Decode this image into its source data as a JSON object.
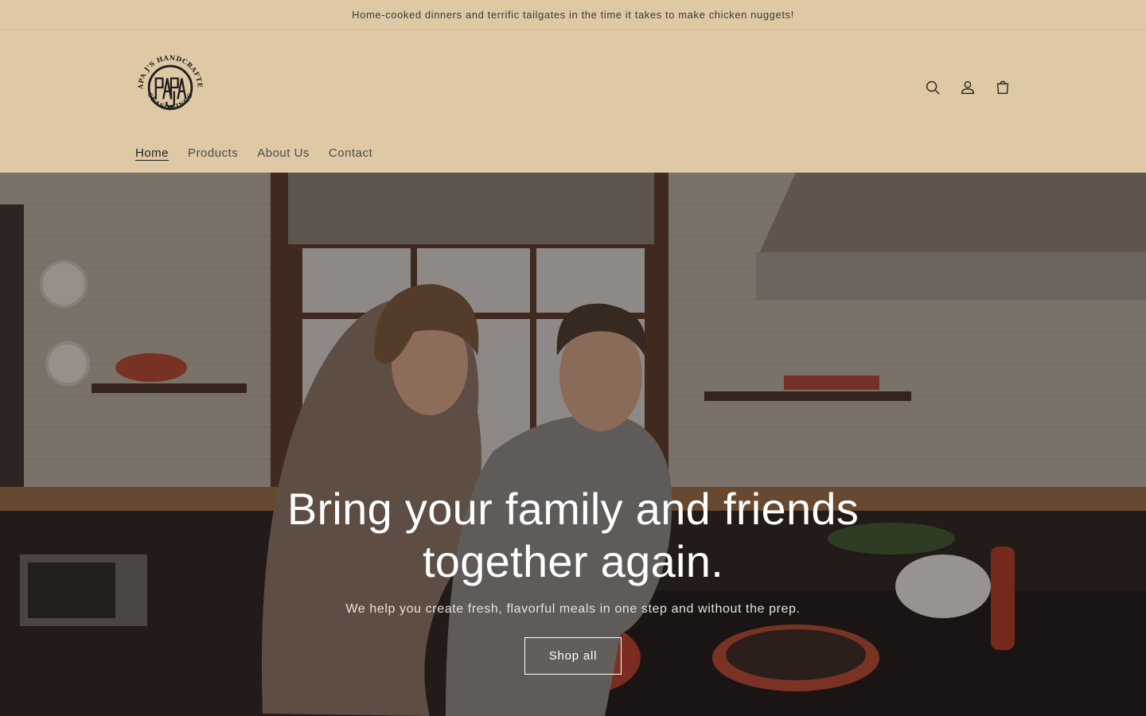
{
  "announcement": {
    "text": "Home-cooked dinners and terrific tailgates in the time it takes to make chicken nuggets!"
  },
  "header": {
    "logo_text_top": "PAPA J'S HANDCRAFTED",
    "logo_text_bottom": "SEASONINGS",
    "logo_monogram": "PAPA J",
    "icons": {
      "search": "search-icon",
      "account": "user-icon",
      "cart": "cart-icon"
    }
  },
  "nav": {
    "items": [
      {
        "label": "Home",
        "active": true
      },
      {
        "label": "Products",
        "active": false
      },
      {
        "label": "About Us",
        "active": false
      },
      {
        "label": "Contact",
        "active": false
      }
    ]
  },
  "hero": {
    "title": "Bring your family and friends together again.",
    "subtitle": "We help you create fresh, flavorful meals in one step and without the prep.",
    "button_label": "Shop all"
  },
  "colors": {
    "background": "#dfc9a5",
    "text": "#2b2b2b",
    "hero_text": "#ffffff"
  }
}
